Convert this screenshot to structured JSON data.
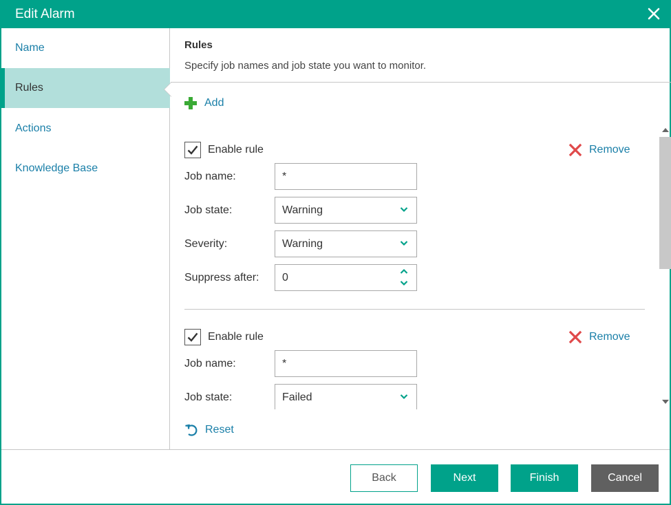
{
  "window": {
    "title": "Edit Alarm"
  },
  "sidebar": {
    "items": [
      {
        "label": "Name"
      },
      {
        "label": "Rules"
      },
      {
        "label": "Actions"
      },
      {
        "label": "Knowledge Base"
      }
    ],
    "active": "Rules"
  },
  "main": {
    "heading": "Rules",
    "subheading": "Specify job names and job state you want to monitor.",
    "add_label": "Add",
    "reset_label": "Reset",
    "rules": [
      {
        "enabled": true,
        "enable_label": "Enable rule",
        "remove_label": "Remove",
        "job_name_label": "Job name:",
        "job_name_value": "*",
        "job_state_label": "Job state:",
        "job_state_value": "Warning",
        "severity_label": "Severity:",
        "severity_value": "Warning",
        "suppress_label": "Suppress after:",
        "suppress_value": "0"
      },
      {
        "enabled": true,
        "enable_label": "Enable rule",
        "remove_label": "Remove",
        "job_name_label": "Job name:",
        "job_name_value": "*",
        "job_state_label": "Job state:",
        "job_state_value": "Failed"
      }
    ]
  },
  "footer": {
    "back_label": "Back",
    "next_label": "Next",
    "finish_label": "Finish",
    "cancel_label": "Cancel"
  },
  "colors": {
    "accent": "#00a28a",
    "active_nav_bg": "#b2dfdb",
    "link": "#1a7fa8",
    "add_icon": "#3aaa35",
    "remove_icon": "#e0494a",
    "cancel_button": "#606060"
  }
}
